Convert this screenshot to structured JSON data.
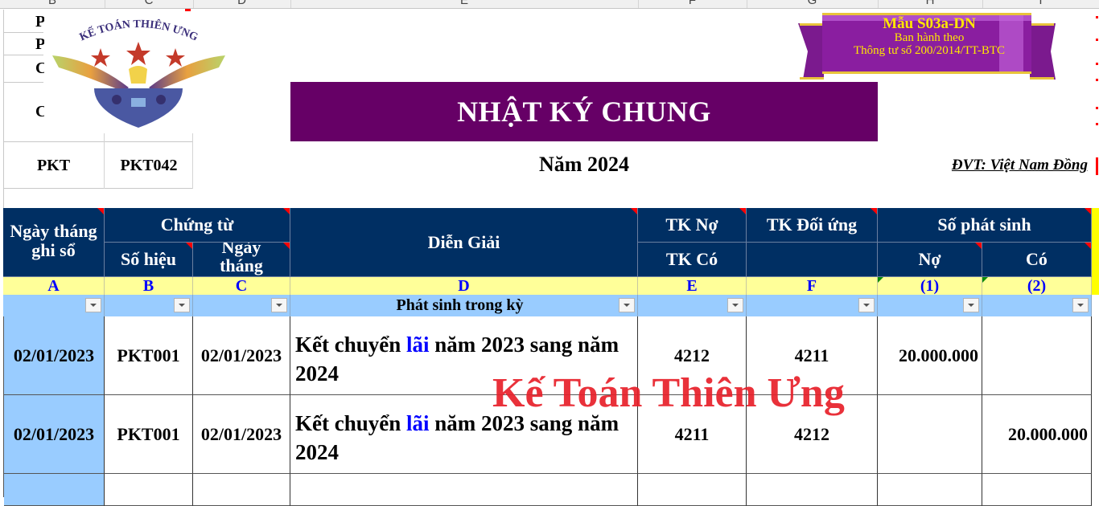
{
  "sheet": {
    "column_letters": [
      "B",
      "C",
      "D",
      "E",
      "F",
      "G",
      "H",
      "I"
    ]
  },
  "info_block": {
    "truncated_labels": [
      "P",
      "P",
      "C",
      "C"
    ],
    "voucher_type_label": "PKT",
    "voucher_number": "PKT042"
  },
  "logo": {
    "arc_text": "KẾ TOÁN THIÊN ƯNG"
  },
  "form_ribbon": {
    "line1": "Mẫu S03a-DN",
    "line2": "Ban hành theo",
    "line3": "Thông tư số 200/2014/TT-BTC"
  },
  "title": "NHẬT KÝ CHUNG",
  "year": "Năm 2024",
  "unit": "ĐVT: Việt Nam Đồng",
  "table": {
    "headers": {
      "date_recorded": "Ngày tháng ghi sổ",
      "voucher_group": "Chứng từ",
      "voucher_no": "Số hiệu",
      "voucher_date": "Ngày tháng",
      "description": "Diễn Giải",
      "tk_no": "TK Nợ",
      "tk_co": "TK Có",
      "tk_doi_ung": "TK Đối ứng",
      "amount_group": "Số phát sinh",
      "debit": "Nợ",
      "credit": "Có"
    },
    "index_row": [
      "A",
      "B",
      "C",
      "D",
      "E",
      "F",
      "(1)",
      "(2)"
    ],
    "filter_row": {
      "description_filter": "Phát sinh trong kỳ"
    },
    "rows": [
      {
        "date_recorded": "02/01/2023",
        "voucher_no": "PKT001",
        "voucher_date": "02/01/2023",
        "desc_pre": "Kết chuyển ",
        "desc_hl": "lãi",
        "desc_post": " năm 2023 sang năm 2024",
        "account": "4212",
        "counter_account": "4211",
        "debit": "20.000.000",
        "credit": ""
      },
      {
        "date_recorded": "02/01/2023",
        "voucher_no": "PKT001",
        "voucher_date": "02/01/2023",
        "desc_pre": "Kết chuyển ",
        "desc_hl": "lãi",
        "desc_post": " năm 2023 sang năm 2024",
        "account": "4211",
        "counter_account": "4212",
        "debit": "",
        "credit": "20.000.000"
      }
    ]
  },
  "watermark": "Kế Toán Thiên Ưng",
  "colors": {
    "title_bg": "#660066",
    "header_bg": "#002f63",
    "index_row_bg": "#ffff99",
    "filter_row_bg": "#99ccff",
    "watermark": "#e8202a",
    "highlight_text": "#0000ff"
  }
}
